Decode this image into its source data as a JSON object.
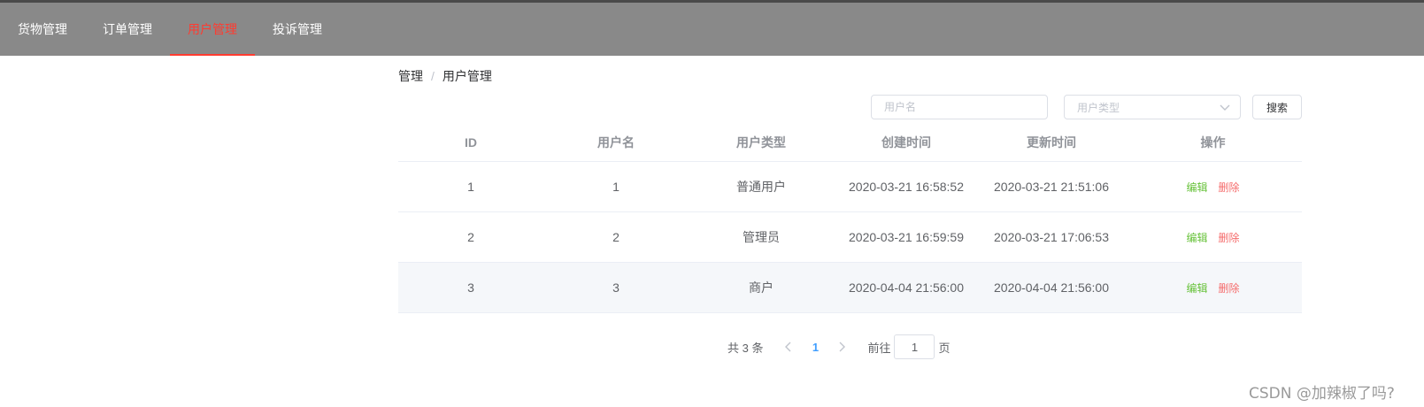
{
  "nav": {
    "items": [
      {
        "label": "货物管理"
      },
      {
        "label": "订单管理"
      },
      {
        "label": "用户管理"
      },
      {
        "label": "投诉管理"
      }
    ]
  },
  "breadcrumb": {
    "root": "管理",
    "separator": "/",
    "current": "用户管理"
  },
  "search": {
    "username_placeholder": "用户名",
    "usertype_placeholder": "用户类型",
    "button_label": "搜索"
  },
  "table": {
    "headers": [
      "ID",
      "用户名",
      "用户类型",
      "创建时间",
      "更新时间",
      "操作"
    ],
    "rows": [
      {
        "id": "1",
        "username": "1",
        "type": "普通用户",
        "created": "2020-03-21 16:58:52",
        "updated": "2020-03-21 21:51:06"
      },
      {
        "id": "2",
        "username": "2",
        "type": "管理员",
        "created": "2020-03-21 16:59:59",
        "updated": "2020-03-21 17:06:53"
      },
      {
        "id": "3",
        "username": "3",
        "type": "商户",
        "created": "2020-04-04 21:56:00",
        "updated": "2020-04-04 21:56:00"
      }
    ],
    "edit_label": "编辑",
    "delete_label": "删除"
  },
  "pagination": {
    "total_text": "共 3 条",
    "current_page": "1",
    "goto_prefix": "前往",
    "goto_value": "1",
    "goto_suffix": "页"
  },
  "watermark": "CSDN @加辣椒了吗?"
}
